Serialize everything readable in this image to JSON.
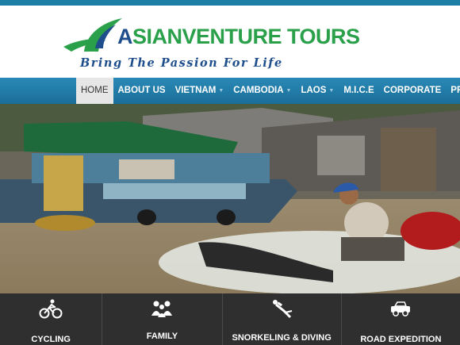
{
  "header": {
    "logo_first": "A",
    "logo_rest": "SIANVENTURE TOURS",
    "tagline": "Bring The Passion For Life"
  },
  "nav": {
    "items": [
      {
        "label": "HOME",
        "active": true,
        "dropdown": false
      },
      {
        "label": "ABOUT US",
        "active": false,
        "dropdown": false
      },
      {
        "label": "VIETNAM",
        "active": false,
        "dropdown": true
      },
      {
        "label": "CAMBODIA",
        "active": false,
        "dropdown": true
      },
      {
        "label": "LAOS",
        "active": false,
        "dropdown": true
      },
      {
        "label": "M.I.C.E",
        "active": false,
        "dropdown": false
      },
      {
        "label": "CORPORATE",
        "active": false,
        "dropdown": false
      },
      {
        "label": "PROMOTION",
        "active": false,
        "dropdown": false
      }
    ]
  },
  "features": {
    "items": [
      {
        "label": "CYCLING",
        "icon": "cyclist-icon"
      },
      {
        "label": "FAMILY",
        "icon": "family-icon"
      },
      {
        "label": "SNORKELING & DIVING",
        "icon": "diver-icon"
      },
      {
        "label": "ROAD EXPEDITION",
        "icon": "jeep-icon"
      }
    ]
  },
  "colors": {
    "brand_blue": "#1e4f8c",
    "brand_green": "#2aa04a",
    "nav_bg": "#2a88b6",
    "features_bg": "#2f2f2f"
  }
}
